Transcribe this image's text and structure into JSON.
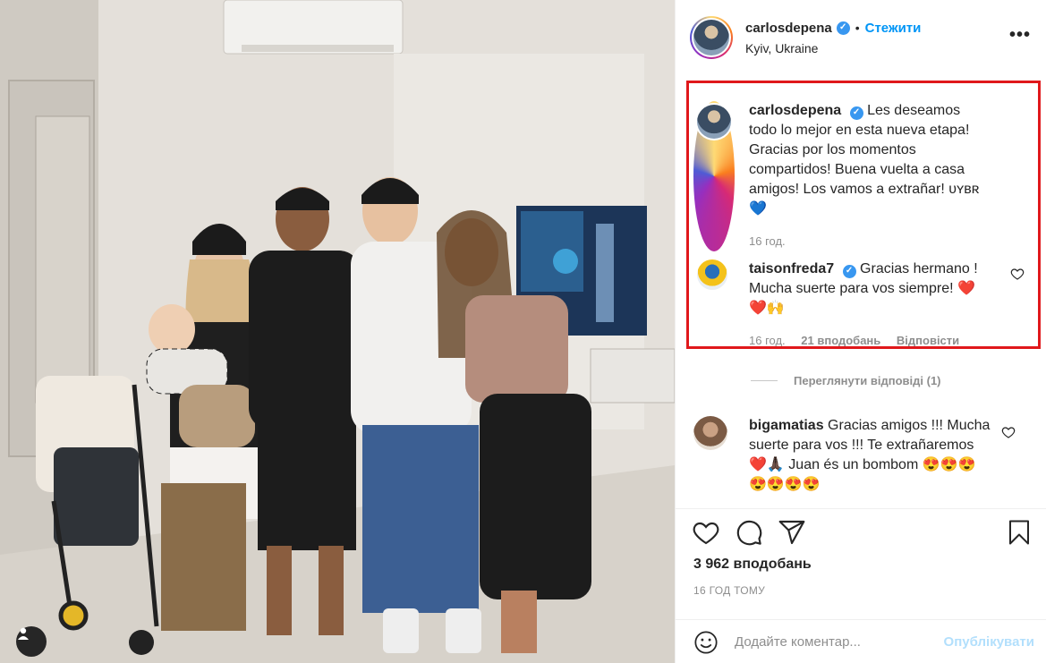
{
  "post": {
    "author": "carlosdepena",
    "follow_label": "Стежити",
    "location": "Kyiv, Ukraine",
    "more_icon": "more-options-icon"
  },
  "caption": {
    "username": "carlosdepena",
    "text": "Les deseamos todo lo mejor en esta nueva etapa! Gracias por los momentos compartidos! Buena vuelta a casa amigos! Los vamos a extrañar! ᴜʏʙʀ💙",
    "time": "16 год."
  },
  "comments": [
    {
      "username": "taisonfreda7",
      "verified": true,
      "text": "Gracias hermano ! Mucha suerte para vos siempre! ❤️❤️🙌",
      "time": "16 год.",
      "likes": "21 вподобань",
      "reply": "Відповісти"
    },
    {
      "username": "bigamatias",
      "verified": false,
      "text": "Gracias amigos !!! Mucha suerte para vos !!! Te extrañaremos ❤️🙏🏿 Juan és un bombom 😍😍😍😍😍😍😍"
    }
  ],
  "view_replies": "Переглянути відповіді (1)",
  "likes_count": "3 962 вподобань",
  "timestamp": "16 ГОД ТОМУ",
  "add_comment": {
    "placeholder": "Додайте коментар...",
    "publish_label": "Опублікувати"
  },
  "colors": {
    "accent": "#0095f6",
    "highlight_border": "#e0181b",
    "verified": "#3897f0"
  }
}
